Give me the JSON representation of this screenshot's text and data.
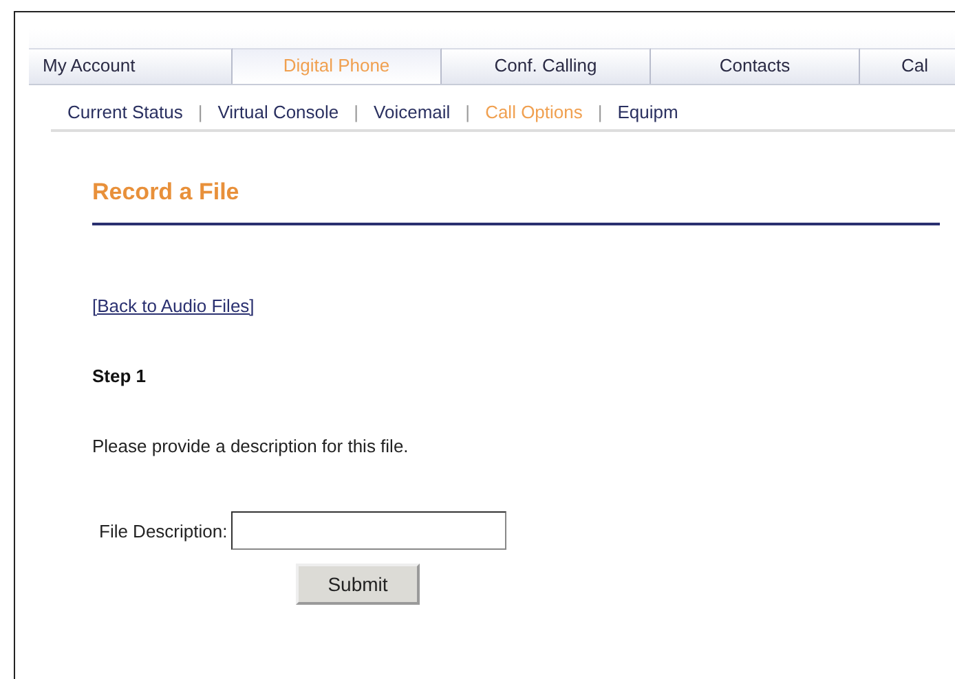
{
  "tabs": [
    {
      "label": "My Account",
      "selected": false
    },
    {
      "label": "Digital Phone",
      "selected": true
    },
    {
      "label": "Conf. Calling",
      "selected": false
    },
    {
      "label": "Contacts",
      "selected": false
    },
    {
      "label": "Cal",
      "selected": false
    }
  ],
  "subnav": [
    {
      "label": "Current Status",
      "selected": false
    },
    {
      "label": "Virtual Console",
      "selected": false
    },
    {
      "label": "Voicemail",
      "selected": false
    },
    {
      "label": "Call Options",
      "selected": true
    },
    {
      "label": "Equipm",
      "selected": false
    }
  ],
  "subnav_separator": "|",
  "heading": "Record a File",
  "back_link": "[Back to Audio Files]",
  "step": "Step 1",
  "instruction": "Please provide a description for this file.",
  "field": {
    "label": "File Description:"
  },
  "submit_button": "Submit"
}
